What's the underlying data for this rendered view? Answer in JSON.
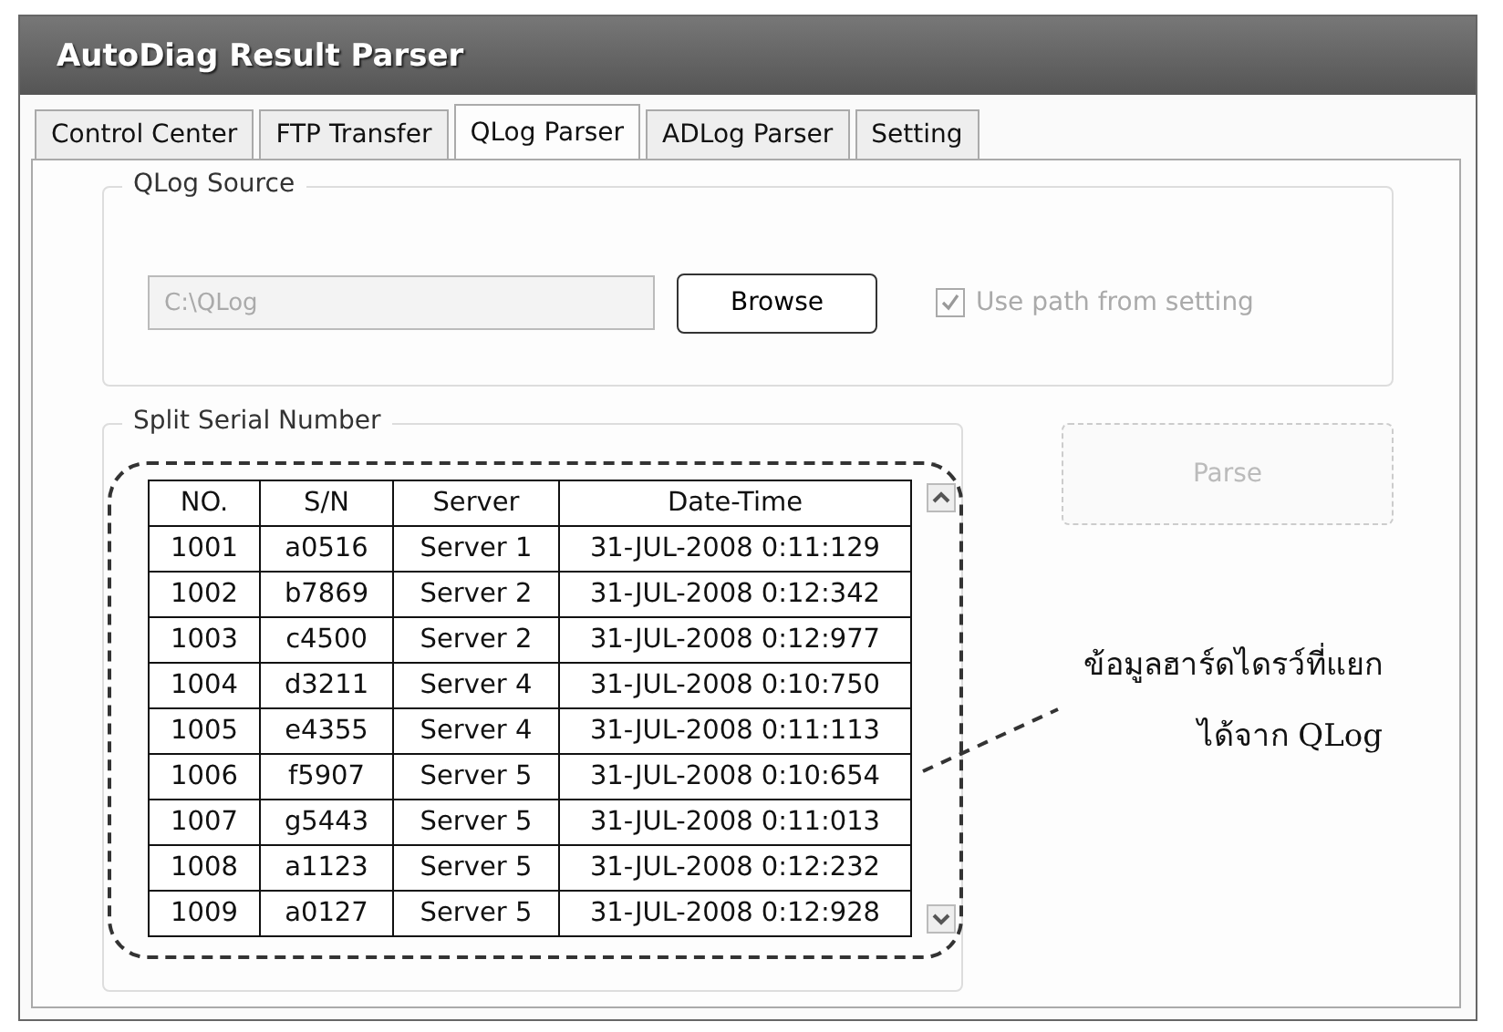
{
  "window": {
    "title": "AutoDiag Result Parser"
  },
  "tabs": [
    {
      "label": "Control Center",
      "selected": false
    },
    {
      "label": "FTP Transfer",
      "selected": false
    },
    {
      "label": "QLog Parser",
      "selected": true
    },
    {
      "label": "ADLog Parser",
      "selected": false
    },
    {
      "label": "Setting",
      "selected": false
    }
  ],
  "qlog_source": {
    "title": "QLog Source",
    "path_field": {
      "value": "C:\\QLog",
      "disabled": true
    },
    "browse_button": {
      "label": "Browse"
    },
    "use_path_checkbox": {
      "label": "Use path from setting",
      "checked": true,
      "disabled": true
    }
  },
  "split_serial": {
    "title": "Split Serial Number",
    "table": {
      "columns": [
        "NO.",
        "S/N",
        "Server",
        "Date-Time"
      ],
      "rows": [
        [
          "1001",
          "a0516",
          "Server 1",
          "31-JUL-2008 0:11:129"
        ],
        [
          "1002",
          "b7869",
          "Server 2",
          "31-JUL-2008 0:12:342"
        ],
        [
          "1003",
          "c4500",
          "Server 2",
          "31-JUL-2008 0:12:977"
        ],
        [
          "1004",
          "d3211",
          "Server 4",
          "31-JUL-2008 0:10:750"
        ],
        [
          "1005",
          "e4355",
          "Server 4",
          "31-JUL-2008 0:11:113"
        ],
        [
          "1006",
          "f5907",
          "Server 5",
          "31-JUL-2008 0:10:654"
        ],
        [
          "1007",
          "g5443",
          "Server 5",
          "31-JUL-2008 0:11:013"
        ],
        [
          "1008",
          "a1123",
          "Server 5",
          "31-JUL-2008 0:12:232"
        ],
        [
          "1009",
          "a0127",
          "Server 5",
          "31-JUL-2008 0:12:928"
        ]
      ]
    }
  },
  "parse_button": {
    "label": "Parse",
    "disabled": true
  },
  "annotation": {
    "lines": [
      "ข้อมูลฮาร์ดไดรว์ที่แยก",
      "ได้จาก QLog"
    ]
  }
}
